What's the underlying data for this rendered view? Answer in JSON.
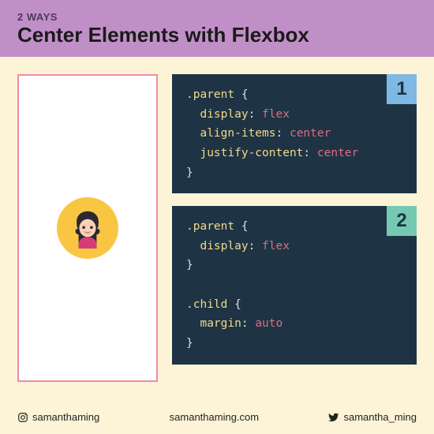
{
  "header": {
    "subtitle": "2 WAYS",
    "title": "Center Elements with Flexbox"
  },
  "code_blocks": [
    {
      "badge": "1",
      "lines": [
        {
          "selector": ".parent",
          "open": " {"
        },
        {
          "indent": true,
          "prop": "display",
          "val": "flex"
        },
        {
          "indent": true,
          "prop": "align-items",
          "val": "center"
        },
        {
          "indent": true,
          "prop": "justify-content",
          "val": "center"
        },
        {
          "close": "}"
        }
      ]
    },
    {
      "badge": "2",
      "lines": [
        {
          "selector": ".parent",
          "open": " {"
        },
        {
          "indent": true,
          "prop": "display",
          "val": "flex"
        },
        {
          "close": "}"
        },
        {
          "blank": true
        },
        {
          "selector": ".child",
          "open": " {"
        },
        {
          "indent": true,
          "prop": "margin",
          "val": "auto"
        },
        {
          "close": "}"
        }
      ]
    }
  ],
  "footer": {
    "instagram": "samanthaming",
    "website": "samanthaming.com",
    "twitter": "samantha_ming"
  }
}
